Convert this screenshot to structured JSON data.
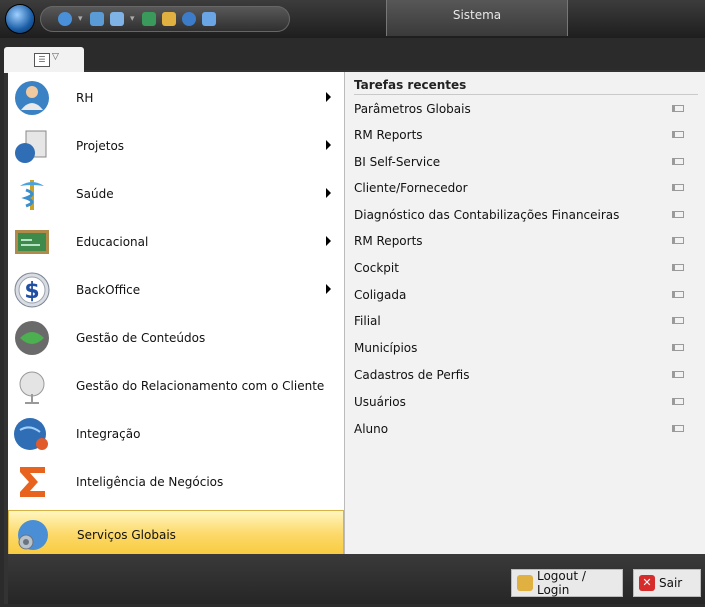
{
  "window": {
    "title": "Sistema"
  },
  "colors": {
    "active_highlight": "#f8c93a",
    "accent": "#1a5da6",
    "exit_red": "#d62c2c"
  },
  "menu": {
    "items": [
      {
        "label": "RH",
        "icon": "people-globe-icon",
        "submenu": true
      },
      {
        "label": "Projetos",
        "icon": "projects-globe-icon",
        "submenu": true
      },
      {
        "label": "Saúde",
        "icon": "caduceus-icon",
        "submenu": true
      },
      {
        "label": "Educacional",
        "icon": "chalkboard-icon",
        "submenu": true
      },
      {
        "label": "BackOffice",
        "icon": "dollar-sign-icon",
        "submenu": true
      },
      {
        "label": "Gestão de Conteúdos",
        "icon": "content-globe-icon",
        "submenu": false
      },
      {
        "label": "Gestão do Relacionamento com o Cliente",
        "icon": "satellite-dish-icon",
        "submenu": false
      },
      {
        "label": "Integração",
        "icon": "integration-globe-icon",
        "submenu": false
      },
      {
        "label": "Inteligência de Negócios",
        "icon": "sigma-icon",
        "submenu": false
      },
      {
        "label": "Serviços Globais",
        "icon": "global-services-icon",
        "submenu": false,
        "active": true
      }
    ]
  },
  "recent": {
    "title": "Tarefas recentes",
    "items": [
      "Parâmetros Globais",
      "RM Reports",
      "BI Self-Service",
      "Cliente/Fornecedor",
      "Diagnóstico das Contabilizações Financeiras",
      "RM Reports",
      "Cockpit",
      "Coligada",
      "Filial",
      "Municípios",
      "Cadastros de Perfis",
      "Usuários",
      "Aluno"
    ]
  },
  "footer": {
    "logout_label": "Logout / Login",
    "exit_label": "Sair"
  }
}
